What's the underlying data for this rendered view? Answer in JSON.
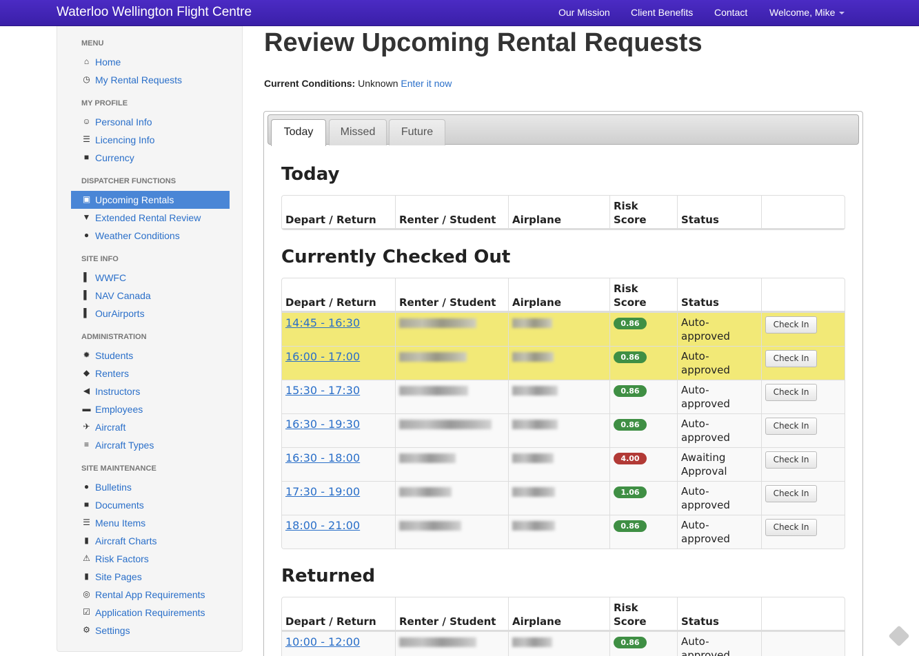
{
  "navbar": {
    "brand": "Waterloo Wellington Flight Centre",
    "links": [
      "Our Mission",
      "Client Benefits",
      "Contact"
    ],
    "user": "Welcome, Mike"
  },
  "sidebar": {
    "sections": [
      {
        "header": "MENU",
        "items": [
          {
            "label": "Home",
            "icon": "home-icon"
          },
          {
            "label": "My Rental Requests",
            "icon": "clock-icon"
          }
        ]
      },
      {
        "header": "MY PROFILE",
        "items": [
          {
            "label": "Personal Info",
            "icon": "user-icon"
          },
          {
            "label": "Licencing Info",
            "icon": "list-icon"
          },
          {
            "label": "Currency",
            "icon": "book-icon"
          }
        ]
      },
      {
        "header": "DISPATCHER FUNCTIONS",
        "items": [
          {
            "label": "Upcoming Rentals",
            "icon": "inbox-icon",
            "active": true
          },
          {
            "label": "Extended Rental Review",
            "icon": "map-marker-icon"
          },
          {
            "label": "Weather Conditions",
            "icon": "globe-icon"
          }
        ]
      },
      {
        "header": "SITE INFO",
        "items": [
          {
            "label": "WWFC",
            "icon": "bookmark-icon"
          },
          {
            "label": "NAV Canada",
            "icon": "bookmark-icon"
          },
          {
            "label": "OurAirports",
            "icon": "bookmark-icon"
          }
        ]
      },
      {
        "header": "ADMINISTRATION",
        "items": [
          {
            "label": "Students",
            "icon": "certificate-icon"
          },
          {
            "label": "Renters",
            "icon": "tags-icon"
          },
          {
            "label": "Instructors",
            "icon": "bullhorn-icon"
          },
          {
            "label": "Employees",
            "icon": "folder-icon"
          },
          {
            "label": "Aircraft",
            "icon": "plane-icon"
          },
          {
            "label": "Aircraft Types",
            "icon": "align-icon"
          }
        ]
      },
      {
        "header": "SITE MAINTENANCE",
        "items": [
          {
            "label": "Bulletins",
            "icon": "info-icon"
          },
          {
            "label": "Documents",
            "icon": "book-icon"
          },
          {
            "label": "Menu Items",
            "icon": "th-list-icon"
          },
          {
            "label": "Aircraft Charts",
            "icon": "file-icon"
          },
          {
            "label": "Risk Factors",
            "icon": "warning-icon"
          },
          {
            "label": "Site Pages",
            "icon": "file-icon"
          },
          {
            "label": "Rental App Requirements",
            "icon": "check-circle-icon"
          },
          {
            "label": "Application Requirements",
            "icon": "check-icon"
          },
          {
            "label": "Settings",
            "icon": "cog-icon"
          }
        ]
      }
    ]
  },
  "main": {
    "title": "Review Upcoming Rental Requests",
    "conditions_label": "Current Conditions:",
    "conditions_value": "Unknown",
    "conditions_link": "Enter it now",
    "tabs": [
      "Today",
      "Missed",
      "Future"
    ],
    "columns": [
      "Depart / Return",
      "Renter / Student",
      "Airplane",
      "Risk Score",
      "Status",
      ""
    ],
    "sections": {
      "today": {
        "title": "Today"
      },
      "checked_out": {
        "title": "Currently Checked Out"
      },
      "returned": {
        "title": "Returned"
      }
    },
    "checked_out_rows": [
      {
        "time": "14:45 - 16:30",
        "risk": "0.86",
        "risk_color": "#3f8f44",
        "status": "Auto-approved",
        "action": "Check In",
        "highlight": true
      },
      {
        "time": "16:00 - 17:00",
        "risk": "0.86",
        "risk_color": "#3f8f44",
        "status": "Auto-approved",
        "action": "Check In",
        "highlight": true
      },
      {
        "time": "15:30 - 17:30",
        "risk": "0.86",
        "risk_color": "#3f8f44",
        "status": "Auto-approved",
        "action": "Check In"
      },
      {
        "time": "16:30 - 19:30",
        "risk": "0.86",
        "risk_color": "#3f8f44",
        "status": "Auto-approved",
        "action": "Check In"
      },
      {
        "time": "16:30 - 18:00",
        "risk": "4.00",
        "risk_color": "#b23a36",
        "status": "Awaiting Approval",
        "action": "Check In"
      },
      {
        "time": "17:30 - 19:00",
        "risk": "1.06",
        "risk_color": "#3f8f44",
        "status": "Auto-approved",
        "action": "Check In"
      },
      {
        "time": "18:00 - 21:00",
        "risk": "0.86",
        "risk_color": "#3f8f44",
        "status": "Auto-approved",
        "action": "Check In"
      }
    ],
    "returned_rows": [
      {
        "time": "10:00 - 12:00",
        "risk": "0.86",
        "risk_color": "#3f8f44",
        "status": "Auto-approved"
      }
    ]
  }
}
